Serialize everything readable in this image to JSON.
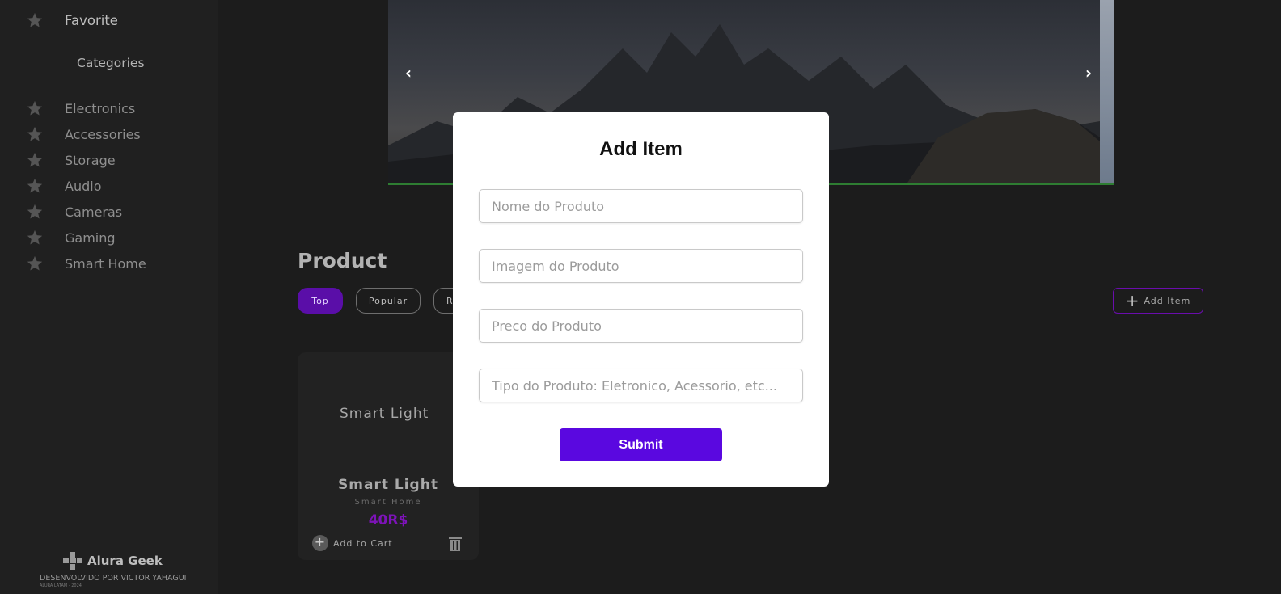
{
  "sidebar": {
    "favorite": {
      "label": "Favorite",
      "icon": "star-icon"
    },
    "categories_title": "Categories",
    "items": [
      {
        "label": "Electronics",
        "icon": "star-icon"
      },
      {
        "label": "Accessories",
        "icon": "star-icon"
      },
      {
        "label": "Storage",
        "icon": "star-icon"
      },
      {
        "label": "Audio",
        "icon": "star-icon"
      },
      {
        "label": "Cameras",
        "icon": "star-icon"
      },
      {
        "label": "Gaming",
        "icon": "star-icon"
      },
      {
        "label": "Smart Home",
        "icon": "star-icon"
      }
    ],
    "brand_name": "Alura Geek",
    "credit": "DESENVOLVIDO POR VICTOR YAHAGUI",
    "copyright": "ALURA LATAM - 2024"
  },
  "carousel": {
    "prev_icon": "chevron-left-icon",
    "next_icon": "chevron-right-icon"
  },
  "products": {
    "title": "Product",
    "filters": [
      {
        "label": "Top",
        "active": true
      },
      {
        "label": "Popular",
        "active": false
      },
      {
        "label": "R",
        "active": false
      }
    ],
    "add_item_label": "Add Item",
    "card": {
      "image_alt": "Smart Light",
      "name": "Smart Light",
      "category": "Smart Home",
      "price": "40R$",
      "add_to_cart": "Add to Cart"
    }
  },
  "modal": {
    "title": "Add Item",
    "fields": {
      "name_placeholder": "Nome do Produto",
      "image_placeholder": "Imagem do Produto",
      "price_placeholder": "Preco do Produto",
      "type_placeholder": "Tipo do Produto: Eletronico, Acessorio, etc..."
    },
    "submit_label": "Submit"
  },
  "colors": {
    "accent_purple": "#5a08e0",
    "price_purple": "#7d13b8",
    "active_filter": "#5a0ea8",
    "background": "#1c1c1c"
  }
}
